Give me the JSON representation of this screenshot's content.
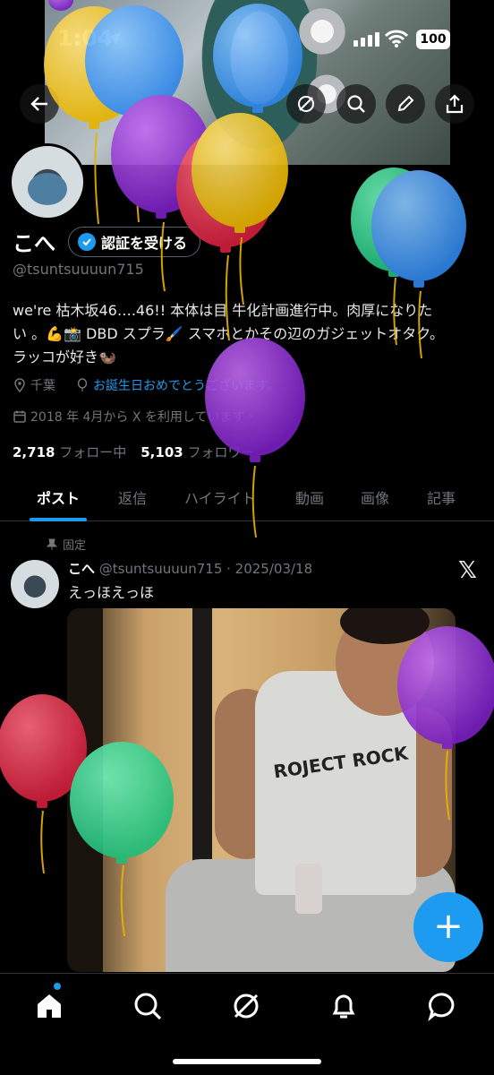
{
  "status_bar": {
    "time": "1:04",
    "battery": "100"
  },
  "profile": {
    "name": "こへ",
    "verify_button": "認証を受ける",
    "handle": "@tsuntsuuuun715",
    "bio_line1": "we're 枯木坂46….46!! 本体は目 牛化計画進行中。肉厚になりた",
    "bio_line2": "い 。💪📸 DBD スプラ🖌️ スマホとかその辺のガジェットオタク。",
    "bio_line3": "ラッコが好き🦦",
    "location": "千葉",
    "birthday": "お誕生日おめでとうございます。",
    "joined": "2018 年 4月から X を利用しています",
    "following_count": "2,718",
    "following_label": "フォロー中",
    "followers_count": "5,103",
    "followers_label": "フォロワー"
  },
  "tabs": [
    "ポスト",
    "返信",
    "ハイライト",
    "動画",
    "画像",
    "記事"
  ],
  "post": {
    "pinned_label": "固定",
    "name": "こへ",
    "handle_date": "@tsuntsuuuun715 · 2025/03/18",
    "text": "えっほえっほ",
    "image_text": "ROJECT ROCK"
  },
  "colors": {
    "accent": "#1d9bf0",
    "background": "#000000",
    "muted": "#71767b"
  },
  "icons": [
    "back-arrow-icon",
    "grok-icon",
    "search-icon",
    "edit-icon",
    "share-icon",
    "home-icon",
    "explore-icon",
    "notifications-icon",
    "messages-icon",
    "pin-icon",
    "location-icon",
    "balloon-icon",
    "calendar-icon",
    "x-logo-icon",
    "compose-icon"
  ]
}
